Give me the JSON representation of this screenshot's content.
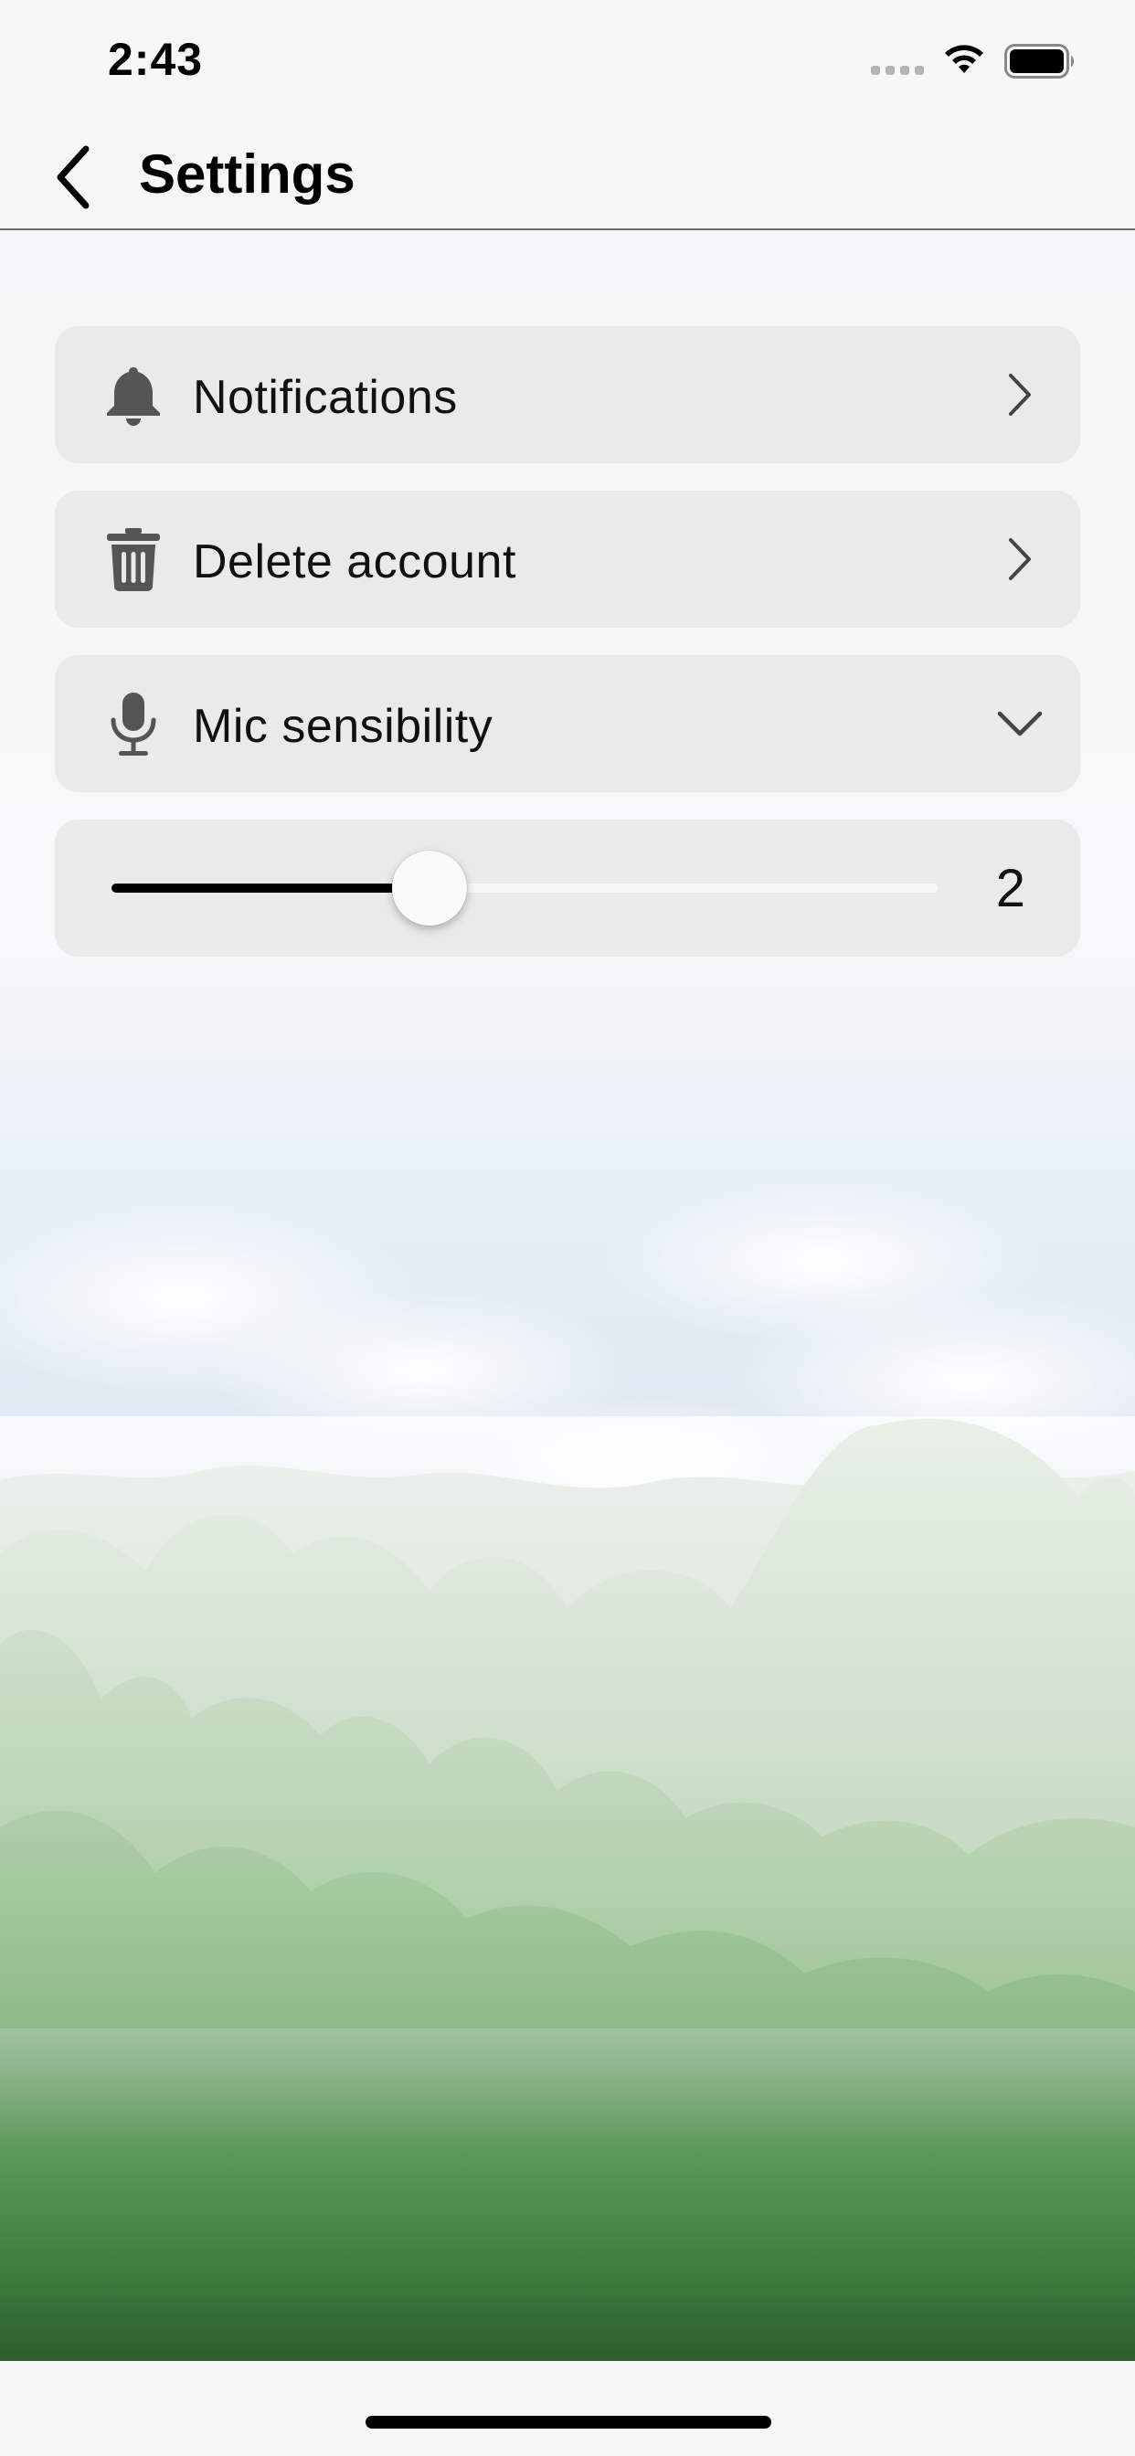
{
  "status_bar": {
    "time": "2:43"
  },
  "nav": {
    "title": "Settings",
    "back_icon": "chevron-left-icon"
  },
  "settings": {
    "items": [
      {
        "label": "Notifications",
        "icon": "bell-icon",
        "accessory": "chevron-right-icon"
      },
      {
        "label": "Delete account",
        "icon": "trash-icon",
        "accessory": "chevron-right-icon"
      },
      {
        "label": "Mic sensibility",
        "icon": "microphone-icon",
        "accessory": "chevron-down-icon"
      }
    ],
    "mic_slider": {
      "value_label": "2",
      "fill_fraction": 0.385
    }
  },
  "colors": {
    "card_background": "#e9e9e9",
    "slider_fill": "#000000",
    "icon_gray": "#555555"
  }
}
